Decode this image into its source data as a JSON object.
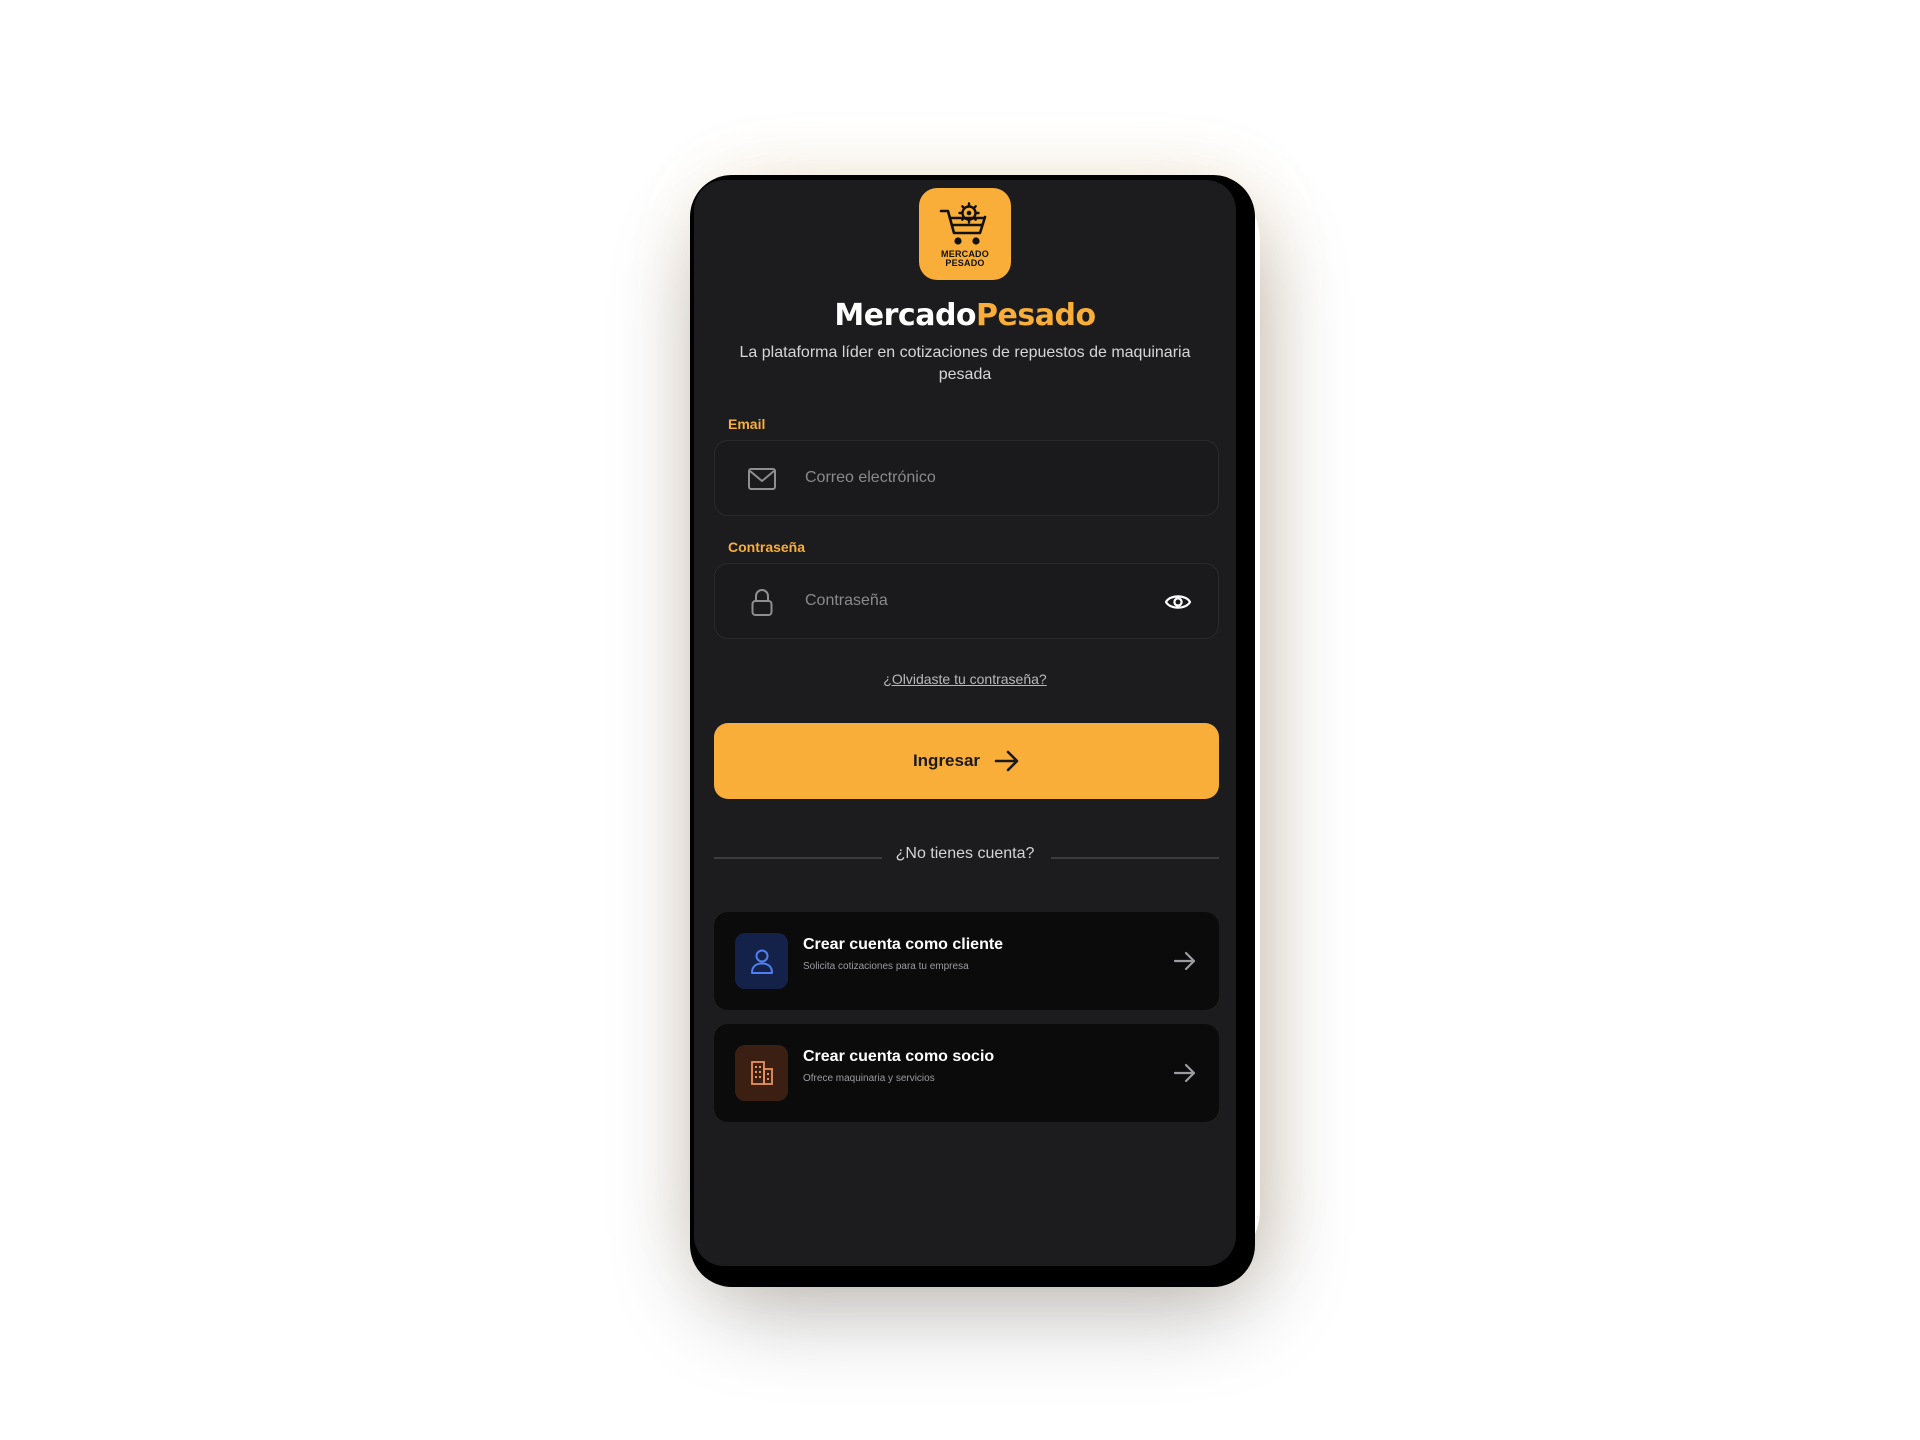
{
  "app": {
    "logo_text_line1": "MERCADO",
    "logo_text_line2": "PESADO",
    "brand_part1": "Mercado",
    "brand_part2": "Pesado",
    "tagline": "La plataforma líder en cotizaciones de repuestos de maquinaria pesada"
  },
  "form": {
    "email_label": "Email",
    "email_placeholder": "Correo electrónico",
    "email_icon": "mail-icon",
    "password_label": "Contraseña",
    "password_placeholder": "Contraseña",
    "password_icon": "lock-icon",
    "show_password_icon": "eye-icon",
    "forgot_link": "¿Olvidaste tu contraseña?",
    "submit_label": "Ingresar"
  },
  "signup": {
    "divider_text": "¿No tienes cuenta?",
    "options": [
      {
        "title": "Crear cuenta como cliente",
        "subtitle": "Solicita cotizaciones para tu empresa",
        "icon": "user-icon"
      },
      {
        "title": "Crear cuenta como socio",
        "subtitle": "Ofrece maquinaria y servicios",
        "icon": "building-icon"
      }
    ]
  },
  "colors": {
    "accent": "#f9ae39",
    "background": "#1c1c1e",
    "card": "#0b0b0c",
    "client_icon_bg": "#14224a",
    "partner_icon_bg": "#3a1f12"
  }
}
